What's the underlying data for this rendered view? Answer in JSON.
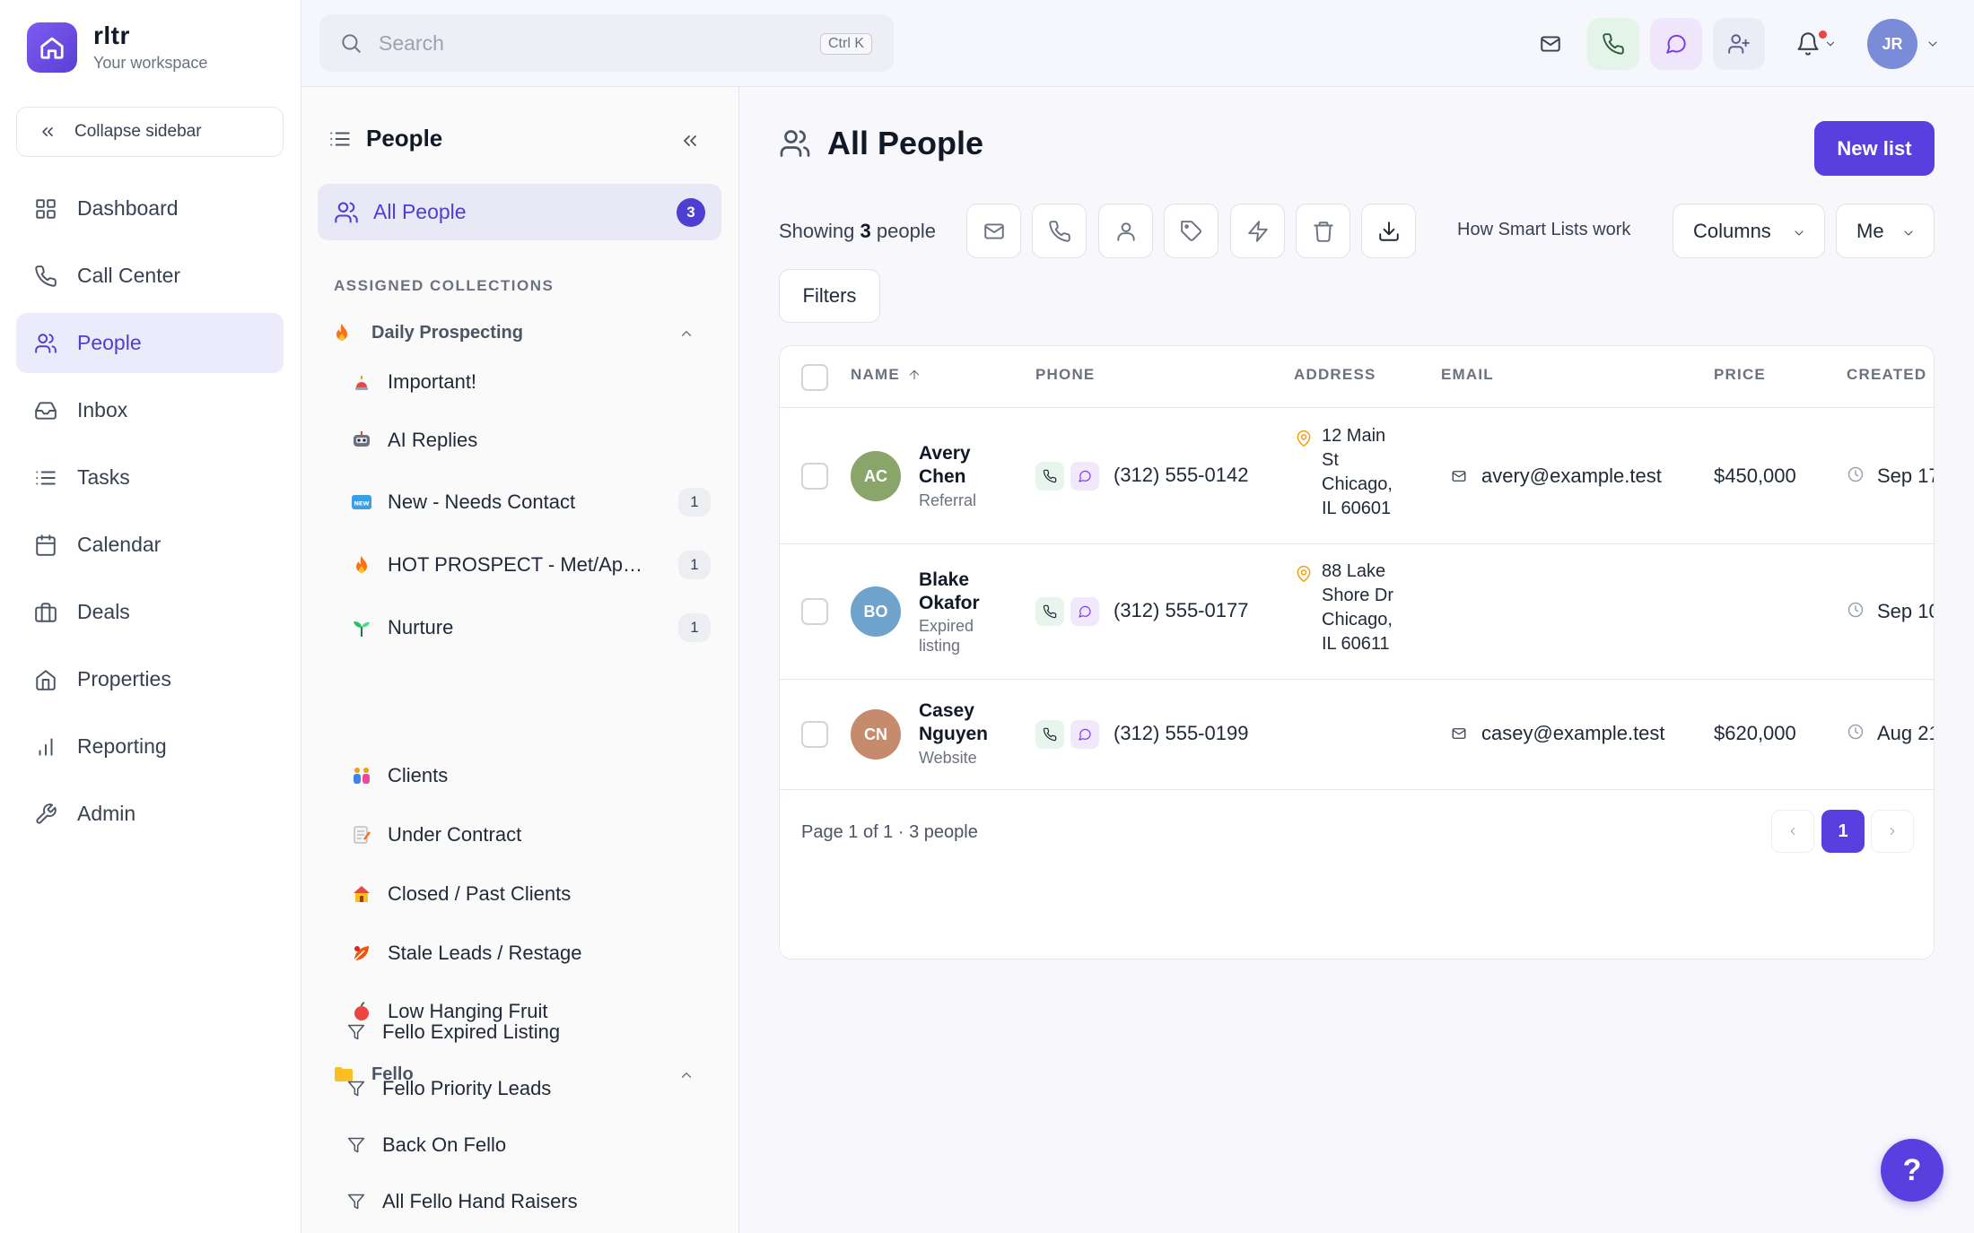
{
  "brand": {
    "name": "rltr",
    "subtitle": "Your workspace"
  },
  "sidebar": {
    "collapse_label": "Collapse sidebar",
    "items": [
      {
        "label": "Dashboard",
        "icon": "grid-icon"
      },
      {
        "label": "Call Center",
        "icon": "phone-icon"
      },
      {
        "label": "People",
        "icon": "users-icon",
        "active": true
      },
      {
        "label": "Inbox",
        "icon": "inbox-icon"
      },
      {
        "label": "Tasks",
        "icon": "list-icon"
      },
      {
        "label": "Calendar",
        "icon": "calendar-icon"
      },
      {
        "label": "Deals",
        "icon": "briefcase-icon"
      },
      {
        "label": "Properties",
        "icon": "home-icon"
      },
      {
        "label": "Reporting",
        "icon": "bar-chart-icon"
      },
      {
        "label": "Admin",
        "icon": "wrench-icon"
      }
    ]
  },
  "topbar": {
    "search_placeholder": "Search",
    "search_shortcut": "Ctrl K",
    "avatar_initials": "JR"
  },
  "panel": {
    "title": "People",
    "all_people_label": "All People",
    "all_people_count": "3",
    "section_label": "ASSIGNED COLLECTIONS",
    "groups": [
      {
        "name": "Daily Prospecting",
        "items": [
          {
            "label": "Important!",
            "count": ""
          },
          {
            "label": "AI Replies",
            "count": ""
          },
          {
            "label": "New - Needs Contact",
            "count": "1"
          },
          {
            "label": "HOT PROSPECT - Met/Appointment Set",
            "count": "1"
          },
          {
            "label": "Nurture",
            "count": "1"
          },
          {
            "label": "Clients",
            "count": ""
          },
          {
            "label": "Under Contract",
            "count": ""
          },
          {
            "label": "Closed / Past Clients",
            "count": ""
          },
          {
            "label": "Stale Leads / Restage",
            "count": ""
          },
          {
            "label": "Low Hanging Fruit",
            "count": ""
          }
        ]
      },
      {
        "name": "Fello",
        "items": [
          {
            "label": "Fello Expired Listing"
          },
          {
            "label": "Fello Priority Leads"
          },
          {
            "label": "Back On Fello"
          },
          {
            "label": "All Fello Hand Raisers"
          }
        ]
      }
    ]
  },
  "main": {
    "title": "All People",
    "new_list_label": "New list",
    "showing_prefix": "Showing",
    "showing_count": "3",
    "showing_suffix": "people",
    "how_link": "How Smart Lists work",
    "columns_label": "Columns",
    "owner_label": "Me",
    "filters_label": "Filters",
    "table": {
      "headers": {
        "name": "NAME",
        "phone": "PHONE",
        "address": "ADDRESS",
        "email": "EMAIL",
        "price": "PRICE",
        "created": "CREATED"
      },
      "rows": [
        {
          "initials": "AC",
          "avatar_color": "#8aa56a",
          "first": "Avery",
          "last": "Chen",
          "source": "Referral",
          "phone": "(312) 555-0142",
          "address": [
            "12 Main",
            "St",
            "Chicago,",
            "IL 60601"
          ],
          "email": "avery@example.test",
          "price": "$450,000",
          "created": "Sep 17"
        },
        {
          "initials": "BO",
          "avatar_color": "#6fa3cc",
          "first": "Blake",
          "last": "Okafor",
          "source": "Expired listing",
          "phone": "(312) 555-0177",
          "address": [
            "88 Lake",
            "Shore Dr",
            "Chicago,",
            "IL 60611"
          ],
          "email": "",
          "price": "",
          "created": "Sep 10"
        },
        {
          "initials": "CN",
          "avatar_color": "#c58b6c",
          "first": "Casey",
          "last": "Nguyen",
          "source": "Website",
          "phone": "(312) 555-0199",
          "address": [],
          "email": "casey@example.test",
          "price": "$620,000",
          "created": "Aug 21"
        }
      ]
    },
    "pagination": {
      "info": "Page 1 of 1 · 3 people",
      "current": "1"
    }
  },
  "help_label": "?",
  "colors": {
    "accent": "#5a3fe0",
    "active_bg": "#ecebfb"
  }
}
